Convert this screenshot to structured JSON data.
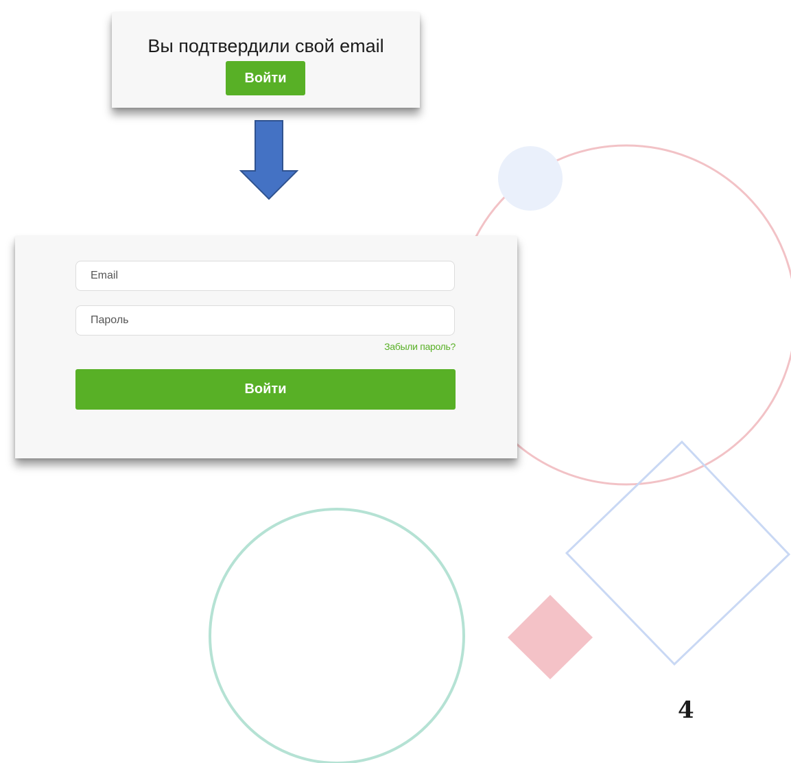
{
  "confirmation": {
    "title": "Вы подтвердили свой email",
    "login_button": "Войти"
  },
  "login_form": {
    "email_placeholder": "Email",
    "password_placeholder": "Пароль",
    "forgot_password_link": "Забыли пароль?",
    "login_button": "Войти"
  },
  "slide": {
    "page_number": "4"
  },
  "colors": {
    "accent_green": "#58b026",
    "arrow_blue": "#4472c4",
    "deco_pink": "#f2c2c6",
    "deco_light_blue": "#eaf0fb",
    "deco_periwinkle": "#c9d8f4",
    "deco_mint": "#b5e2d4"
  },
  "icons": {
    "flow_arrow": "arrow-down-icon"
  }
}
